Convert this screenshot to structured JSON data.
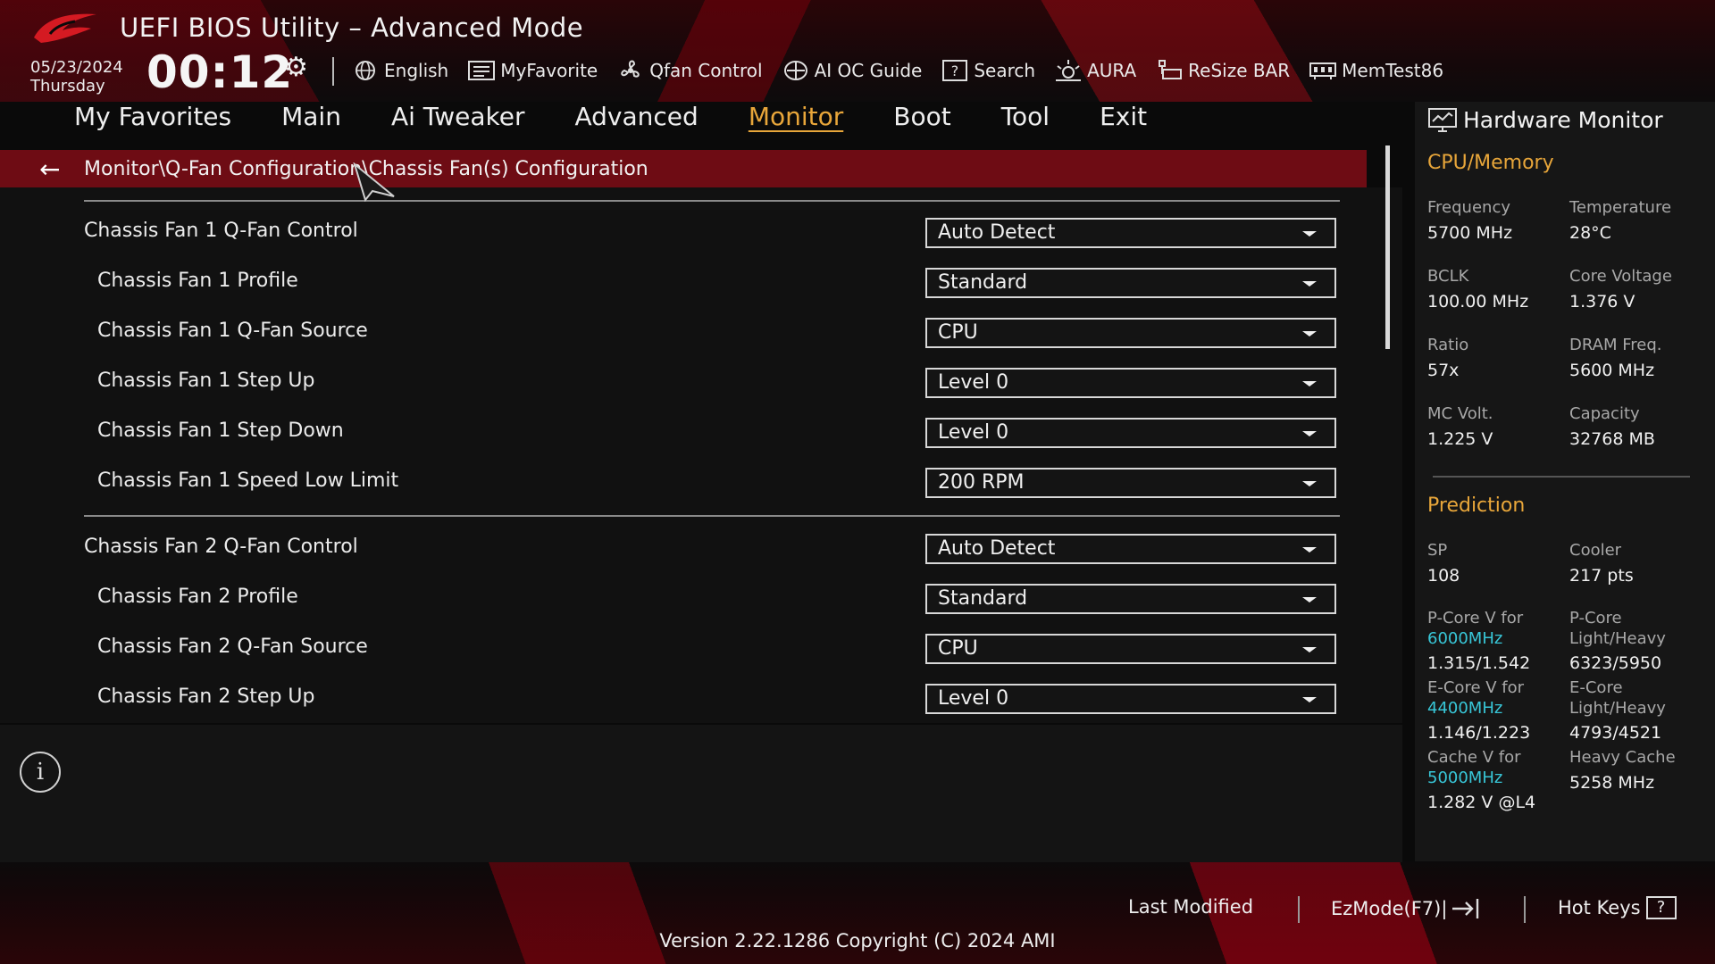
{
  "header": {
    "title": "UEFI BIOS Utility – Advanced Mode",
    "date": "05/23/2024",
    "day": "Thursday",
    "time": "00:12"
  },
  "toolbar": [
    {
      "label": "English",
      "icon": "globe-icon"
    },
    {
      "label": "MyFavorite",
      "icon": "favorite-list-icon"
    },
    {
      "label": "Qfan Control",
      "icon": "fan-icon"
    },
    {
      "label": "AI OC Guide",
      "icon": "ai-chip-icon"
    },
    {
      "label": "Search",
      "icon": "question-box-icon"
    },
    {
      "label": "AURA",
      "icon": "aura-light-icon"
    },
    {
      "label": "ReSize BAR",
      "icon": "resize-bar-icon"
    },
    {
      "label": "MemTest86",
      "icon": "memory-icon"
    }
  ],
  "tabs": [
    "My Favorites",
    "Main",
    "Ai Tweaker",
    "Advanced",
    "Monitor",
    "Boot",
    "Tool",
    "Exit"
  ],
  "active_tab": "Monitor",
  "breadcrumb": "Monitor\\Q-Fan Configuration\\Chassis Fan(s) Configuration",
  "settings": [
    {
      "label": "Chassis Fan 1 Q-Fan Control",
      "value": "Auto Detect",
      "indent": false
    },
    {
      "label": "Chassis Fan 1 Profile",
      "value": "Standard",
      "indent": true
    },
    {
      "label": "Chassis Fan 1 Q-Fan Source",
      "value": "CPU",
      "indent": true
    },
    {
      "label": "Chassis Fan 1 Step Up",
      "value": "Level 0",
      "indent": true
    },
    {
      "label": "Chassis Fan 1 Step Down",
      "value": "Level 0",
      "indent": true
    },
    {
      "label": "Chassis Fan 1 Speed Low Limit",
      "value": "200 RPM",
      "indent": true
    },
    {
      "label": "Chassis Fan 2 Q-Fan Control",
      "value": "Auto Detect",
      "indent": false
    },
    {
      "label": "Chassis Fan 2 Profile",
      "value": "Standard",
      "indent": true
    },
    {
      "label": "Chassis Fan 2 Q-Fan Source",
      "value": "CPU",
      "indent": true
    },
    {
      "label": "Chassis Fan 2 Step Up",
      "value": "Level 0",
      "indent": true
    }
  ],
  "hardware_monitor": {
    "title": "Hardware Monitor",
    "cpu_memory": {
      "heading": "CPU/Memory",
      "frequency_label": "Frequency",
      "frequency": "5700 MHz",
      "temperature_label": "Temperature",
      "temperature": "28°C",
      "bclk_label": "BCLK",
      "bclk": "100.00 MHz",
      "core_voltage_label": "Core Voltage",
      "core_voltage": "1.376 V",
      "ratio_label": "Ratio",
      "ratio": "57x",
      "dram_freq_label": "DRAM Freq.",
      "dram_freq": "5600 MHz",
      "mc_volt_label": "MC Volt.",
      "mc_volt": "1.225 V",
      "capacity_label": "Capacity",
      "capacity": "32768 MB"
    },
    "prediction": {
      "heading": "Prediction",
      "sp_label": "SP",
      "sp": "108",
      "cooler_label": "Cooler",
      "cooler": "217 pts",
      "pcore_v_label": "P-Core V for",
      "pcore_v_freq": "6000MHz",
      "pcore_v": "1.315/1.542",
      "pcore_lh_label1": "P-Core",
      "pcore_lh_label2": "Light/Heavy",
      "pcore_lh": "6323/5950",
      "ecore_v_label": "E-Core V for",
      "ecore_v_freq": "4400MHz",
      "ecore_v": "1.146/1.223",
      "ecore_lh_label1": "E-Core",
      "ecore_lh_label2": "Light/Heavy",
      "ecore_lh": "4793/4521",
      "cache_v_label": "Cache V for",
      "cache_v_freq": "5000MHz",
      "cache_v": "1.282 V @L4",
      "heavy_cache_label": "Heavy Cache",
      "heavy_cache": "5258 MHz"
    }
  },
  "footer": {
    "last_modified": "Last Modified",
    "ezmode": "EzMode(F7)|",
    "hot_keys": "Hot Keys",
    "version": "Version 2.22.1286 Copyright (C) 2024 AMI"
  },
  "colors": {
    "accent": "#e8a63a",
    "breadcrumb_bg": "#6e0c14",
    "highlight_cyan": "#38c7d8"
  }
}
